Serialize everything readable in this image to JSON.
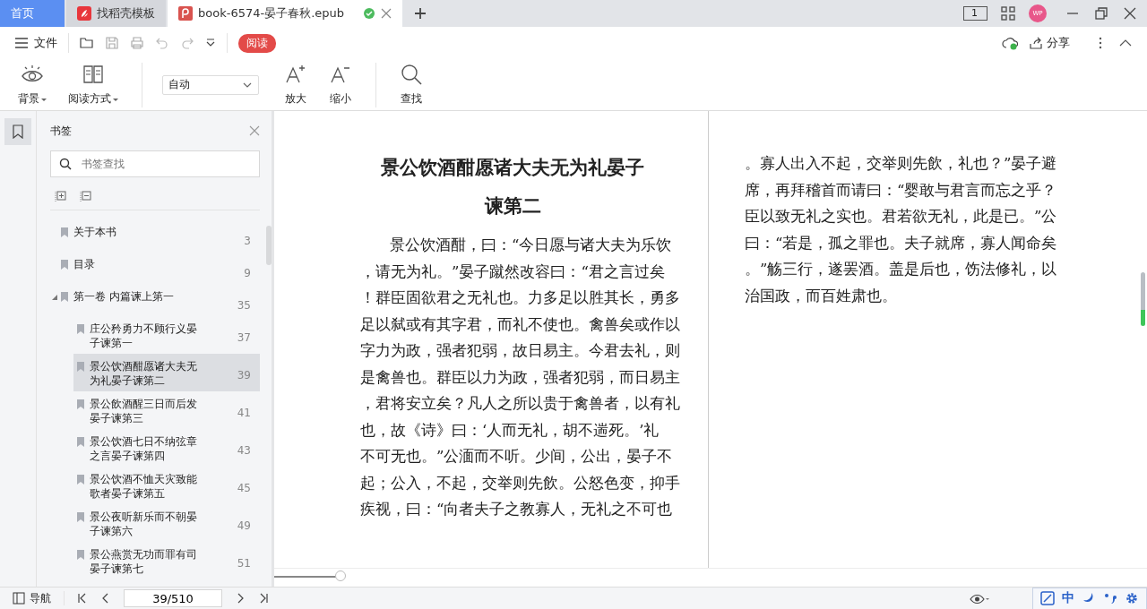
{
  "tabs": [
    {
      "kind": "home",
      "label": "首页",
      "selected": false
    },
    {
      "kind": "template",
      "label": "找稻壳模板",
      "selected": false
    },
    {
      "kind": "document",
      "label": "book-6574-晏子春秋.epub",
      "selected": true,
      "saved": true
    }
  ],
  "window_controls": {
    "layout_number": "1",
    "avatar": "WP"
  },
  "toolbar": {
    "file_menu": "文件",
    "read_button": "阅读",
    "share": "分享"
  },
  "ribbon": {
    "background": "背景",
    "read_mode": "阅读方式",
    "font_select": "自动",
    "zoom_in": "放大",
    "zoom_out": "缩小",
    "find": "查找"
  },
  "bookmarks": {
    "title": "书签",
    "search_placeholder": "书签查找",
    "items": [
      {
        "label": "关于本书",
        "page": "3",
        "selected": false
      },
      {
        "label": "目录",
        "page": "9",
        "selected": false
      },
      {
        "label": "第一卷 内篇谏上第一",
        "page": "35",
        "selected": false,
        "expanded": true,
        "children": [
          {
            "label": "庄公矜勇力不顾行义晏子谏第一",
            "page": "37",
            "selected": false
          },
          {
            "label": "景公饮酒酣愿诸大夫无为礼晏子谏第二",
            "page": "39",
            "selected": true
          },
          {
            "label": "景公飲酒醒三日而后发晏子谏第三",
            "page": "41",
            "selected": false
          },
          {
            "label": "景公饮酒七日不纳弦章之言晏子谏第四",
            "page": "43",
            "selected": false
          },
          {
            "label": "景公饮酒不恤天灾致能歌者晏子谏第五",
            "page": "45",
            "selected": false
          },
          {
            "label": "景公夜听新乐而不朝晏子谏第六",
            "page": "49",
            "selected": false
          },
          {
            "label": "景公燕赏无功而罪有司晏子谏第七",
            "page": "51",
            "selected": false
          }
        ]
      }
    ]
  },
  "left_page": {
    "title_lines": [
      "景公饮酒酣愿诸大夫无为礼晏子",
      "谏第二"
    ],
    "lines": [
      "景公饮酒酣，曰：“今日愿与诸大夫为乐饮",
      "，请无为礼。”晏子蹴然改容曰：“君之言过矣",
      "！群臣固欲君之无礼也。力多足以胜其长，勇多",
      "足以弑或有其字君，而礼不使也。禽兽矣或作以",
      "字力为政，强者犯弱，故日易主。今君去礼，则",
      "是禽兽也。群臣以力为政，强者犯弱，而日易主",
      "，君将安立矣？凡人之所以贵于禽兽者，以有礼",
      "也，故《诗》曰：‘人而无礼，胡不遄死。’礼",
      "不可无也。”公湎而不听。少间，公出，晏子不",
      "起；公入，不起，交举则先飲。公怒色变，抑手",
      "疾视，曰：“向者夫子之教寡人，无礼之不可也"
    ]
  },
  "right_page": {
    "lines": [
      "。寡人出入不起，交举则先飲，礼也？”晏子避",
      "席，再拜稽首而请曰：“婴敢与君言而忘之乎？",
      "臣以致无礼之实也。君若欲无礼，此是已。”公",
      "曰：“若是，孤之罪也。夫子就席，寡人闻命矣",
      "。”觞三行，遂罢酒。盖是后也，饬法修礼，以",
      "治国政，而百姓肃也。"
    ]
  },
  "progress": {
    "level": 0.076
  },
  "status_bar": {
    "navigation": "导航",
    "page_field": "39/510",
    "language": "中"
  }
}
